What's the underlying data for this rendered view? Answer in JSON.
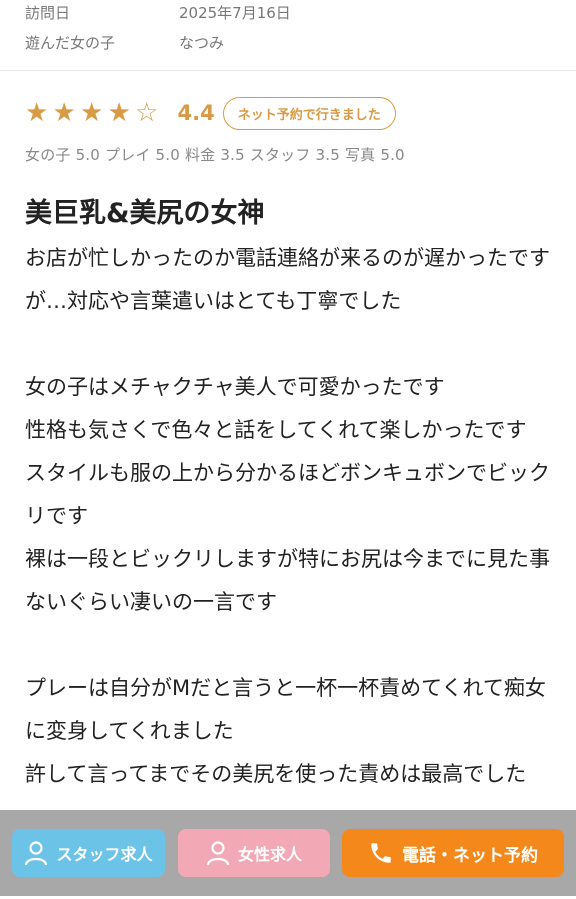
{
  "meta": {
    "visit_label": "訪問日",
    "visit_value": "2025年7月16日",
    "girl_label": "遊んだ女の子",
    "girl_value": "なつみ"
  },
  "rating": {
    "stars_filled": 4,
    "stars_total": 5,
    "score": "4.4",
    "badge": "ネット予約で行きました",
    "sub_scores": "女の子 5.0 プレイ 5.0 料金 3.5 スタッフ 3.5 写真 5.0",
    "accent_color": "#d99a45"
  },
  "review": {
    "title": "美巨乳&美尻の女神",
    "paragraphs": [
      [
        "お店が忙しかったのか電話連絡が来るのが遅かったですが…対応や言葉遣いはとても丁寧でした"
      ],
      [
        "女の子はメチャクチャ美人で可愛かったです",
        "性格も気さくで色々と話をしてくれて楽しかったです",
        "スタイルも服の上から分かるほどボンキュボンでビックリです",
        "裸は一段とビックリしますが特にお尻は今までに見た事ないぐらい凄いの一言です"
      ],
      [
        "プレーは自分がMだと言うと一杯一杯責めてくれて痴女に変身してくれました",
        "許して言ってまでその美尻を使った責めは最高でした"
      ]
    ]
  },
  "bottom_bar": {
    "staff_button": "スタッフ求人",
    "female_button": "女性求人",
    "reserve_button": "電話・ネット予約",
    "staff_color": "#6cc3e8",
    "female_color": "#f2a9b5",
    "reserve_color": "#f5881a"
  }
}
